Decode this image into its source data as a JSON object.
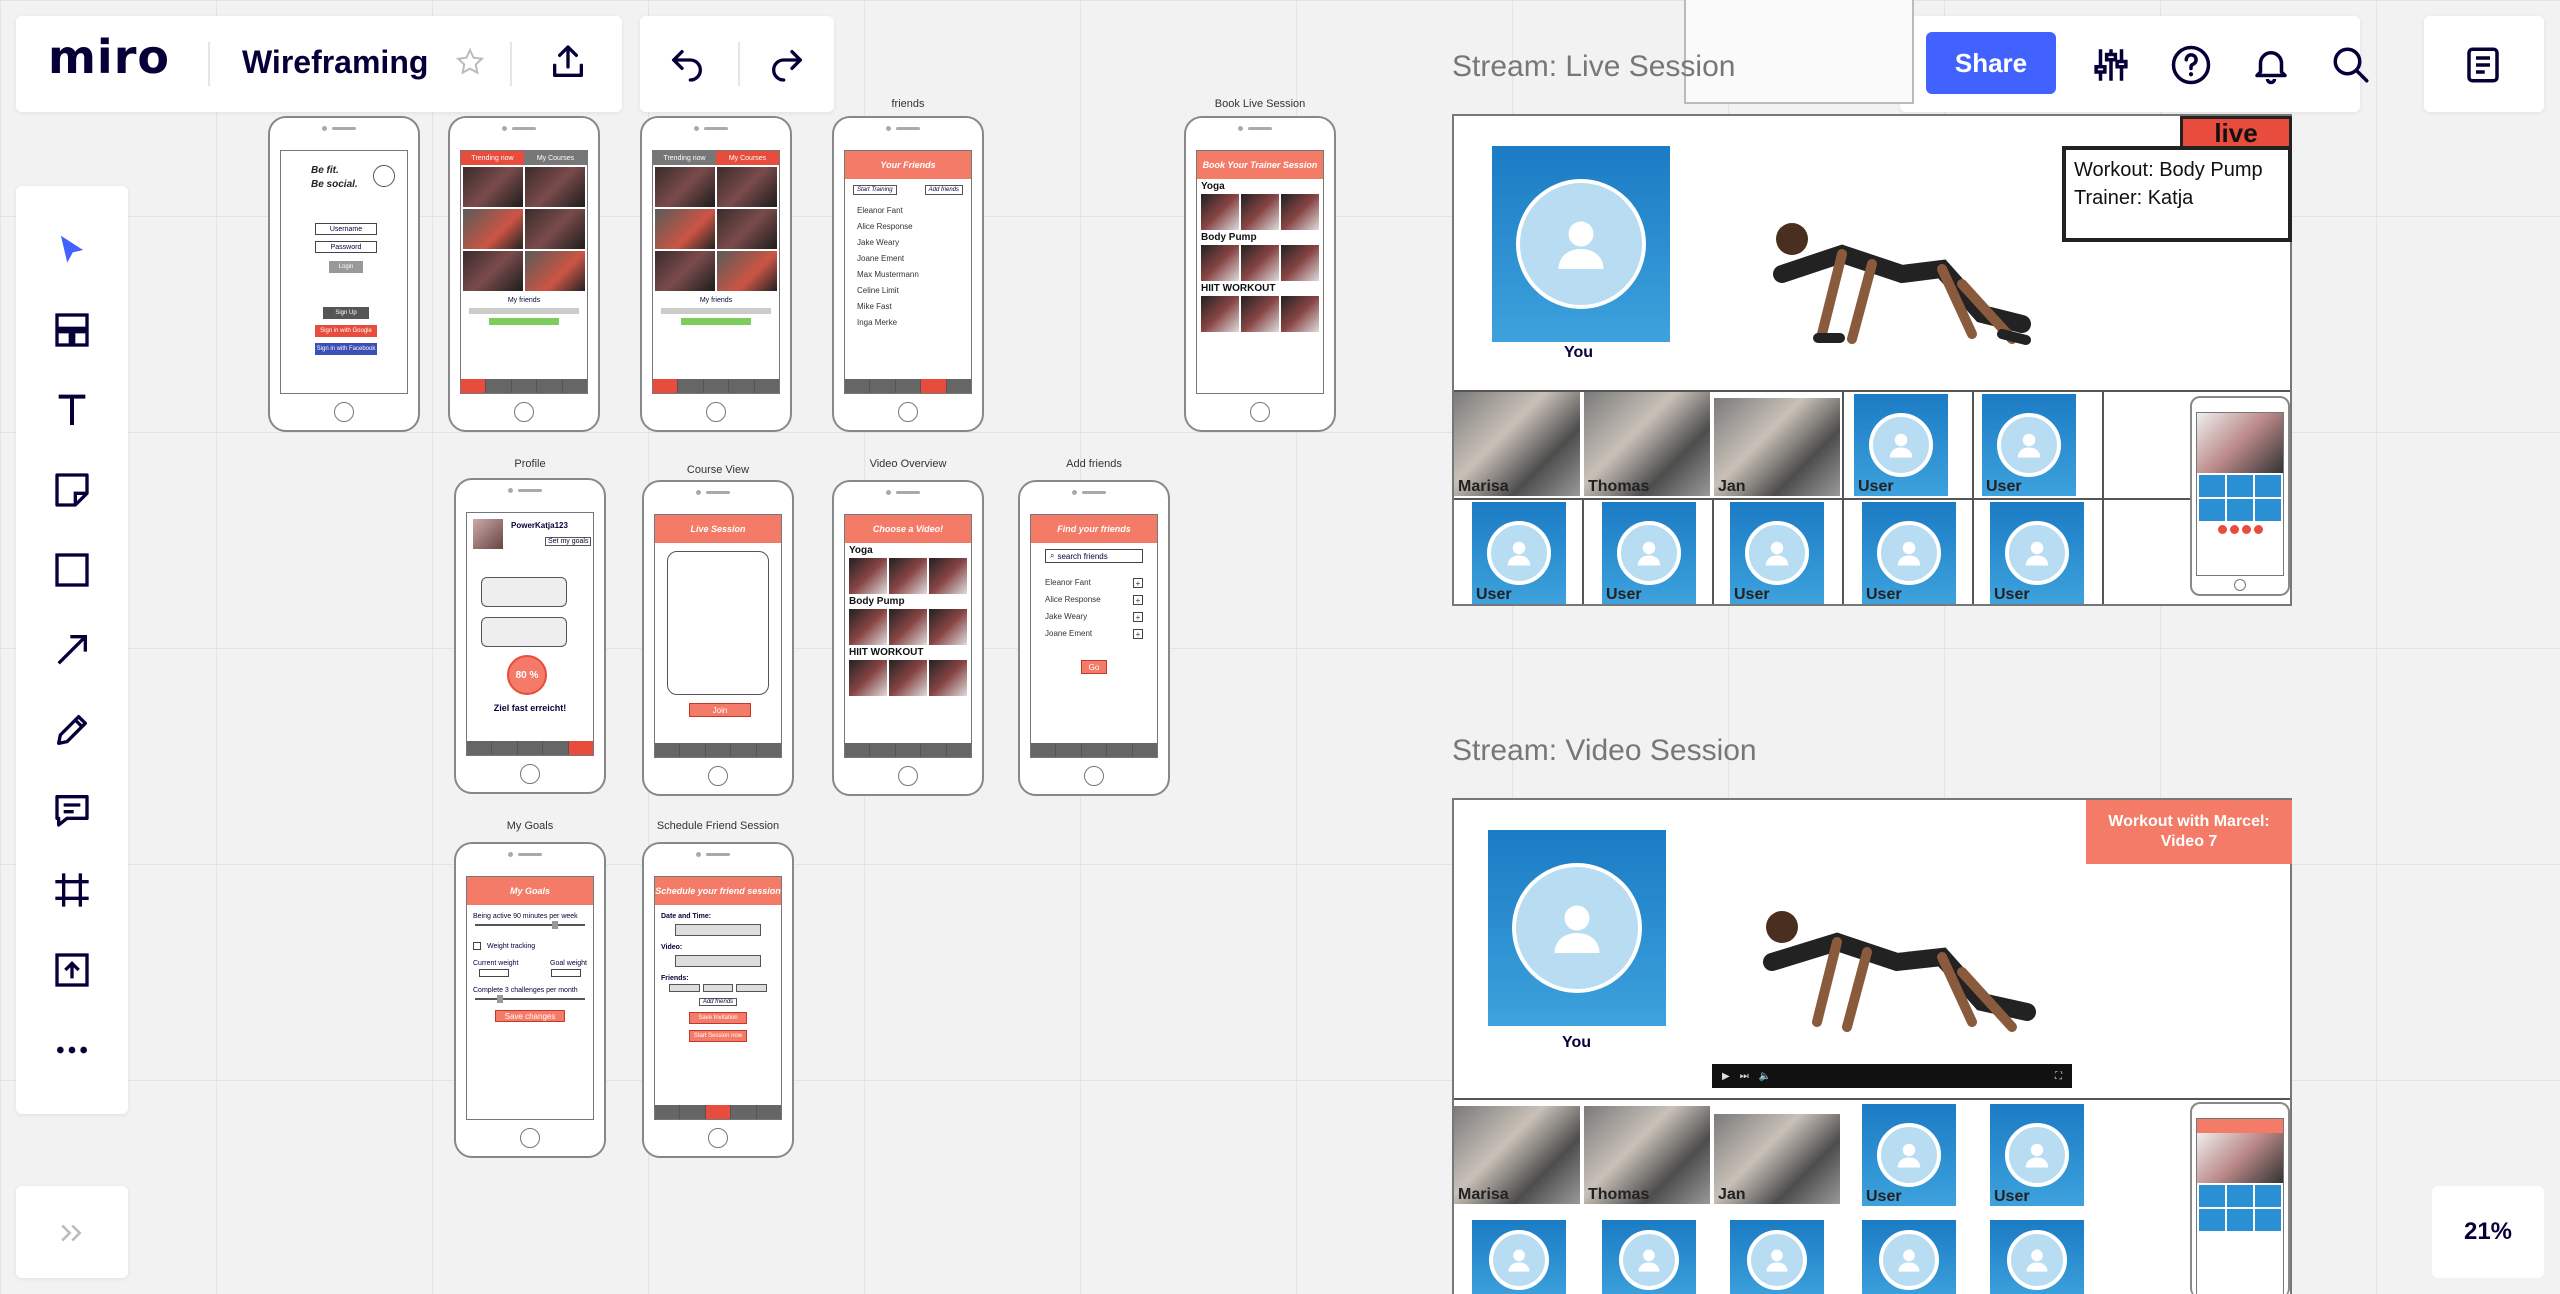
{
  "app": {
    "logo": "miro",
    "board_title": "Wireframing",
    "zoom_level": "21%"
  },
  "header": {
    "share_label": "Share"
  },
  "toolbar": {
    "tools": [
      "select-icon",
      "templates-icon",
      "text-icon",
      "sticky-note-icon",
      "shape-icon",
      "arrow-icon",
      "pen-icon",
      "comment-icon",
      "frame-icon",
      "upload-icon",
      "more-icon"
    ]
  },
  "wireframes": {
    "login": {
      "line1": "Be fit.",
      "line2": "Be social.",
      "username": "Username",
      "password": "Password",
      "login": "Login",
      "signup": "Sign Up",
      "google": "Sign in with Google",
      "facebook": "Sign in with Facebook"
    },
    "feed": {
      "tab1": "Trending now",
      "tab2": "My Courses",
      "my_friends": "My friends"
    },
    "feed2": {
      "tab1": "Trending now",
      "tab2": "My Courses",
      "my_friends": "My friends"
    },
    "friends": {
      "label": "friends",
      "header": "Your Friends",
      "start": "Start Training",
      "add": "Add friends",
      "list": [
        "Eleanor Fant",
        "Alice Response",
        "Jake Weary",
        "Joane Ement",
        "Max Mustermann",
        "Celine Limit",
        "Mike Fast",
        "Inga Merke"
      ]
    },
    "book_live": {
      "label": "Book Live Session",
      "header": "Book Your Trainer Session",
      "cats": [
        "Yoga",
        "Body Pump",
        "HIIT WORKOUT"
      ]
    },
    "profile": {
      "label": "Profile",
      "user": "PowerKatja123",
      "goals_btn": "Set my goals",
      "pct": "80 %",
      "caption": "Ziel fast erreicht!"
    },
    "course": {
      "label": "Course View",
      "header": "Live Session",
      "join": "Join"
    },
    "video_overview": {
      "label": "Video Overview",
      "header": "Choose a Video!",
      "cats": [
        "Yoga",
        "Body Pump",
        "HIIT WORKOUT"
      ]
    },
    "add_friends": {
      "label": "Add friends",
      "header": "Find your friends",
      "search": "search friends",
      "list": [
        "Eleanor Fant",
        "Alice Response",
        "Jake Weary",
        "Joane Ement"
      ],
      "go": "Go"
    },
    "goals": {
      "label": "My Goals",
      "header": "My Goals",
      "active": "Being active 90 minutes per week",
      "weight": "Weight tracking",
      "current": "Current weight",
      "goal": "Goal weight",
      "challenges": "Complete 3 challenges per month",
      "save": "Save changes"
    },
    "schedule": {
      "label": "Schedule Friend Session",
      "header": "Schedule your friend session",
      "date": "Date and Time:",
      "video": "Video:",
      "friends": "Friends:",
      "add": "Add friends",
      "btn1": "Save Invitation",
      "btn2": "Start Session now"
    }
  },
  "live_stream": {
    "title": "Stream: Live Session",
    "badge": "live",
    "workout": "Workout: Body Pump",
    "trainer": "Trainer: Katja",
    "you": "You",
    "participants": [
      "Marisa",
      "Thomas",
      "Jan",
      "User",
      "User"
    ],
    "users_row2": [
      "User",
      "User",
      "User",
      "User",
      "User"
    ]
  },
  "video_stream": {
    "title": "Stream: Video Session",
    "banner": "Workout with Marcel: Video 7",
    "you": "You",
    "participants": [
      "Marisa",
      "Thomas",
      "Jan",
      "User",
      "User"
    ]
  }
}
